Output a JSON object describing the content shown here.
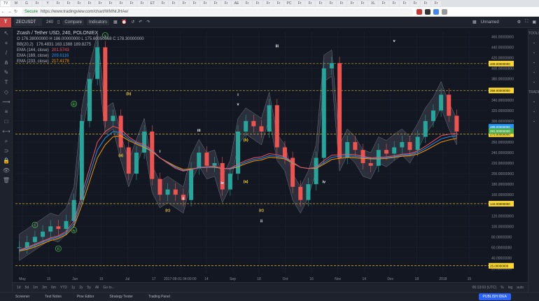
{
  "browser": {
    "tabs": [
      "TV",
      "M",
      "G",
      "Fr",
      "Y",
      "Fr",
      "Fr",
      "Fr",
      "Fr",
      "Fr",
      "Fr",
      "Fr",
      "Fr",
      "Fr",
      "ET",
      "Fr",
      "Fr",
      "Fr",
      "Fr",
      "Fr",
      "Fr",
      "Fr",
      "AE",
      "Fr",
      "Fr",
      "Fr",
      "Fr",
      "PC",
      "Fr",
      "Fr",
      "Fr",
      "Fr",
      "Fr",
      "Fr",
      "Fr",
      "XL",
      "Fr",
      "Fr",
      "Fr",
      "Fr",
      "Fr",
      "Fr"
    ],
    "secure_label": "Secure",
    "url": "https://www.tradingview.com/chart/WMNrJHAe/",
    "accent_color": "#c33333"
  },
  "header": {
    "symbol": "ZECUSDT",
    "interval": "240",
    "compare_label": "Compare",
    "indicators_label": "Indicators",
    "layout_name": "Unnamed"
  },
  "legend": {
    "title": "Zcash / Tether USD, 240, POLONIEX",
    "ohlc": "O 176.38000000   H 186.00000000   L 175.60050568   C 178.30000000",
    "indicators": [
      {
        "name": "BB(20,2)",
        "value": "176.4831  163.1388  189.8275",
        "color": "#b2b5be"
      },
      {
        "name": "EMA (144, close)",
        "value": "201.5743",
        "color": "#f7525f"
      },
      {
        "name": "EMA (169, close)",
        "value": "209.6116",
        "color": "#2196f3"
      },
      {
        "name": "EMA (233, close)",
        "value": "217.4178",
        "color": "#ff9800"
      }
    ]
  },
  "chart_data": {
    "type": "line",
    "title": "Zcash / Tether USD, 240, POLONIEX",
    "ylim": [
      10,
      470
    ],
    "y_ticks": [
      "460.00000000",
      "440.00000000",
      "420.00000000",
      "400.00000000",
      "380.00000000",
      "360.00000000",
      "340.00000000",
      "320.00000000",
      "300.00000000",
      "280.00000000",
      "260.00000000",
      "240.00000000",
      "220.00000000",
      "200.00000000",
      "180.00000000",
      "160.00000000",
      "140.00000000",
      "120.00000000",
      "100.00000000",
      "80.00000000",
      "60.00000000",
      "40.00000000",
      "20.00000000"
    ],
    "x_ticks": [
      "May",
      "15",
      "Jun",
      "15",
      "Jul",
      "17",
      "2017-08-01 04:00:00",
      "14",
      "Sep",
      "18",
      "Oct",
      "16",
      "Nov",
      "14",
      "Dec",
      "18",
      "2018",
      "15"
    ],
    "horizontal_lines": [
      {
        "value": 409.0,
        "label": "409.00000000",
        "color": "#fdd835"
      },
      {
        "value": 358.0,
        "label": "358.00000000",
        "color": "#fdd835"
      },
      {
        "value": 275.0,
        "label": "275.00000000",
        "color": "#fdd835"
      },
      {
        "value": 143.0,
        "label": "143.00000000",
        "color": "#fdd835"
      },
      {
        "value": 25.0,
        "label": "25.00000000",
        "color": "#fdd835"
      }
    ],
    "price_labels": [
      {
        "value": 289.0,
        "label": "289.00000000",
        "color": "#2196f3"
      },
      {
        "value": 281.0,
        "label": "281.00000000",
        "color": "#4caf50"
      }
    ],
    "price_series": [
      60,
      70,
      80,
      90,
      100,
      95,
      110,
      150,
      300,
      380,
      440,
      300,
      310,
      250,
      200,
      240,
      280,
      190,
      160,
      170,
      160,
      150,
      210,
      240,
      215,
      220,
      170,
      200,
      280,
      300,
      290,
      280,
      330,
      250,
      230,
      175,
      150,
      180,
      230,
      400,
      410,
      230,
      260,
      245,
      220,
      215,
      245,
      238,
      250,
      260,
      245,
      270,
      300,
      320,
      350,
      310,
      280
    ],
    "ema144": [
      55,
      60,
      66,
      72,
      78,
      82,
      90,
      110,
      160,
      210,
      260,
      280,
      290,
      285,
      270,
      260,
      255,
      245,
      230,
      220,
      210,
      205,
      208,
      212,
      213,
      214,
      210,
      210,
      218,
      225,
      230,
      232,
      238,
      236,
      232,
      222,
      212,
      210,
      212,
      225,
      235,
      236,
      237,
      236,
      233,
      230,
      231,
      232,
      234,
      237,
      238,
      243,
      252,
      262,
      272,
      275,
      276
    ],
    "ema169": [
      54,
      58,
      64,
      70,
      76,
      80,
      87,
      105,
      150,
      198,
      245,
      268,
      280,
      278,
      266,
      258,
      252,
      243,
      230,
      221,
      212,
      206,
      208,
      211,
      212,
      213,
      210,
      209,
      215,
      222,
      227,
      229,
      234,
      233,
      230,
      221,
      212,
      210,
      211,
      221,
      231,
      233,
      234,
      233,
      231,
      229,
      229,
      230,
      232,
      235,
      236,
      240,
      248,
      257,
      266,
      270,
      272
    ],
    "ema233": [
      53,
      56,
      61,
      67,
      73,
      77,
      84,
      100,
      140,
      185,
      230,
      255,
      270,
      272,
      263,
      256,
      250,
      242,
      230,
      222,
      214,
      208,
      209,
      211,
      212,
      212,
      210,
      209,
      213,
      219,
      224,
      226,
      231,
      230,
      228,
      220,
      212,
      210,
      210,
      218,
      227,
      229,
      231,
      230,
      229,
      228,
      228,
      229,
      231,
      233,
      234,
      237,
      244,
      252,
      260,
      264,
      267
    ],
    "wave_labels": [
      {
        "text": "i",
        "index": 2,
        "value": 100,
        "color": "#4caf50"
      },
      {
        "text": "ii",
        "index": 5,
        "value": 55,
        "color": "#4caf50"
      },
      {
        "text": "iii",
        "index": 7,
        "value": 330,
        "color": "#4caf50"
      },
      {
        "text": "iv",
        "index": 7,
        "value": 90,
        "color": "#4caf50"
      },
      {
        "text": "v",
        "index": 11,
        "value": 460,
        "color": "#4caf50"
      },
      {
        "text": "(b)",
        "index": 14,
        "value": 350,
        "color": "#fdd835"
      },
      {
        "text": "(a)",
        "index": 13,
        "value": 233,
        "color": "#fdd835"
      },
      {
        "text": "(c)",
        "index": 19,
        "value": 128,
        "color": "#fdd835"
      },
      {
        "text": "i",
        "index": 18,
        "value": 240,
        "color": "#ffffff"
      },
      {
        "text": "ii",
        "index": 21,
        "value": 150,
        "color": "#ffffff"
      },
      {
        "text": "iii",
        "index": 23,
        "value": 280,
        "color": "#ffffff"
      },
      {
        "text": "iv",
        "index": 26,
        "value": 180,
        "color": "#ffffff"
      },
      {
        "text": "i",
        "index": 28,
        "value": 348,
        "color": "#ffffff"
      },
      {
        "text": "v",
        "index": 28,
        "value": 330,
        "color": "#ffffff"
      },
      {
        "text": "(b)",
        "index": 29,
        "value": 262,
        "color": "#fdd835"
      },
      {
        "text": "(a)",
        "index": 29,
        "value": 183,
        "color": "#fdd835"
      },
      {
        "text": "(c)",
        "index": 31,
        "value": 128,
        "color": "#fdd835"
      },
      {
        "text": "ii",
        "index": 31,
        "value": 108,
        "color": "#ffffff"
      },
      {
        "text": "iii",
        "index": 33,
        "value": 440,
        "color": "#ffffff"
      },
      {
        "text": "iv",
        "index": 39,
        "value": 182,
        "color": "#ffffff"
      },
      {
        "text": "v",
        "index": 48,
        "value": 450,
        "color": "#ffffff"
      }
    ]
  },
  "bottom_bar": {
    "ranges": [
      "1d",
      "5d",
      "1m",
      "3m",
      "6m",
      "YTD",
      "1y",
      "2y",
      "5y",
      "All",
      "Go to..."
    ],
    "clock": "06:13:03 (UTC)",
    "modes": [
      "%",
      "log",
      "auto"
    ]
  },
  "footer": {
    "tabs": [
      "Screener",
      "Text Notes",
      "Pine Editor",
      "Strategy Tester",
      "Trading Panel"
    ],
    "publish_label": "PUBLISH IDEA"
  },
  "left_tools": [
    "cursor-icon",
    "crosshair-icon",
    "trendline-icon",
    "pitchfork-icon",
    "brush-icon",
    "text-icon",
    "pattern-icon",
    "prediction-icon",
    "fib-icon",
    "shapes-icon",
    "measure-icon",
    "zoom-icon",
    "magnet-icon",
    "lock-icon",
    "eye-icon",
    "trash-icon"
  ],
  "right_tools": [
    "TOOLS",
    "watchlist-icon",
    "alert-icon",
    "calendar-icon",
    "chat-icon",
    "ideas-icon",
    "TRADE",
    "streams-icon",
    "notification-icon",
    "help-icon"
  ]
}
